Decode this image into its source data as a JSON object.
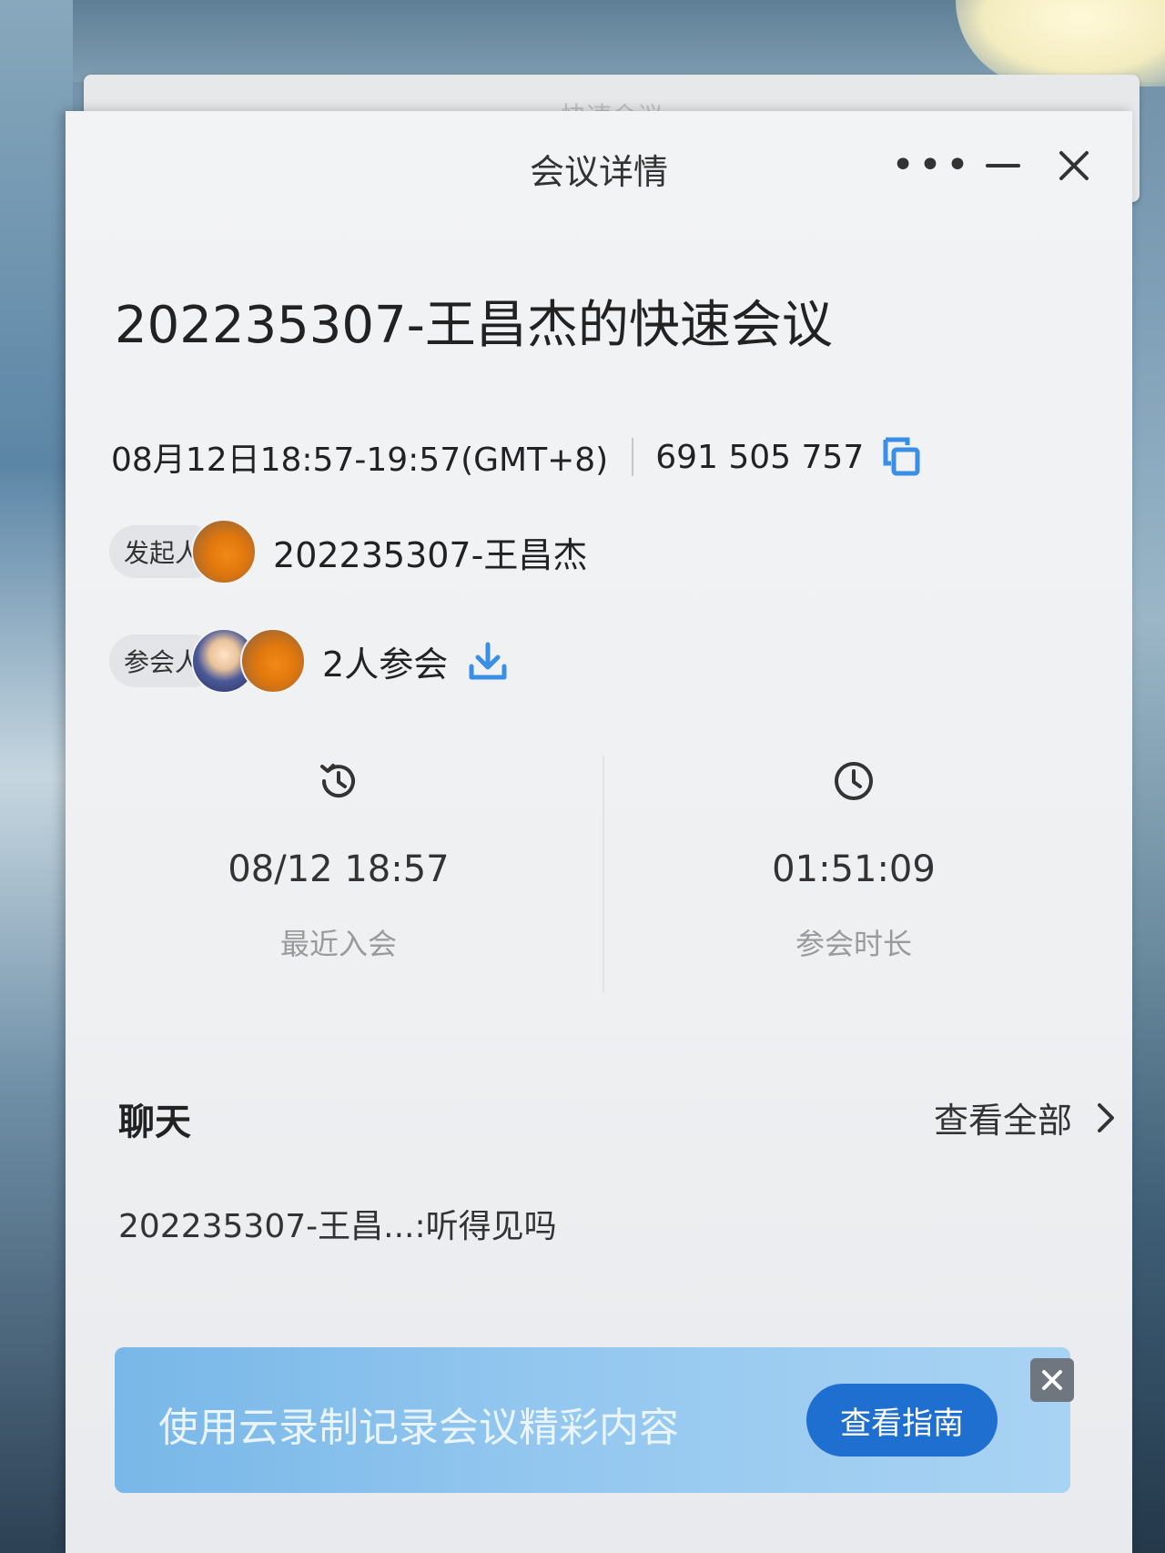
{
  "background_window": {
    "title": "快速会议"
  },
  "window": {
    "title": "会议详情",
    "more_icon": "more-dots-icon",
    "min_icon": "minimize-icon",
    "close_icon": "close-icon"
  },
  "meeting": {
    "title": "202235307-王昌杰的快速会议",
    "time": "08月12日18:57-19:57(GMT+8)",
    "id": "691 505 757",
    "copy_icon": "copy-icon"
  },
  "host": {
    "tag": "发起人",
    "name": "202235307-王昌杰"
  },
  "attendees": {
    "tag": "参会人",
    "count_text": "2人参会",
    "download_icon": "download-icon"
  },
  "stats": {
    "recent_join": {
      "value": "08/12 18:57",
      "label": "最近入会",
      "icon": "history-clock-icon"
    },
    "duration": {
      "value": "01:51:09",
      "label": "参会时长",
      "icon": "clock-icon"
    }
  },
  "chat": {
    "title": "聊天",
    "view_all": "查看全部",
    "message": "202235307-王昌...:听得见吗"
  },
  "banner": {
    "text": "使用云录制记录会议精彩内容",
    "button": "查看指南"
  },
  "colors": {
    "accent": "#1f6fd0",
    "icon_blue": "#3a8ee6",
    "banner_bg": "#93c7ef"
  }
}
